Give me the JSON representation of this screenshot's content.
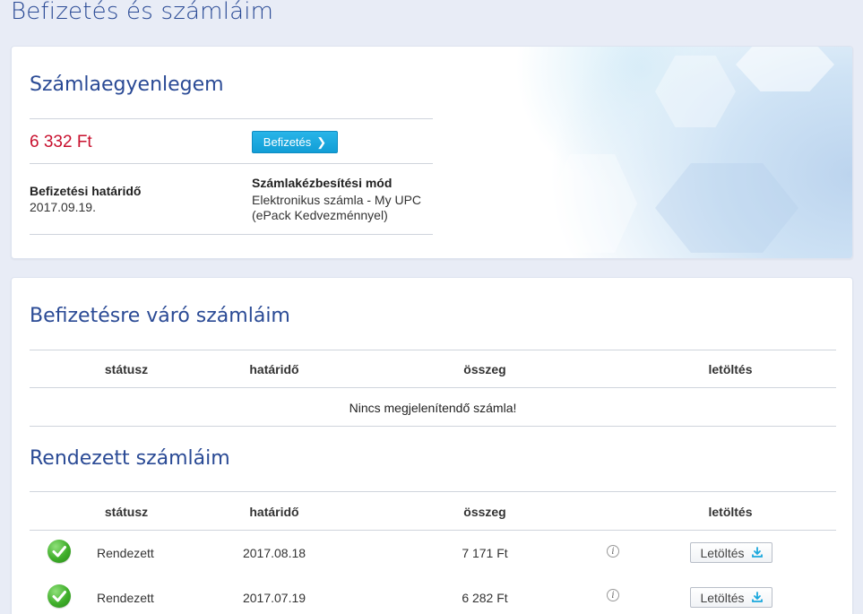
{
  "page": {
    "title": "Befizetés és számláim"
  },
  "balance": {
    "heading": "Számlaegyenlegem",
    "amount": "6 332 Ft",
    "pay_button": "Befizetés",
    "due_label": "Befizetési határidő",
    "due_value": "2017.09.19.",
    "delivery_label": "Számlakézbesítési mód",
    "delivery_value_line1": "Elektronikus számla - My UPC",
    "delivery_value_line2": "(ePack Kedvezménnyel)"
  },
  "pending": {
    "heading": "Befizetésre váró számláim",
    "columns": [
      "státusz",
      "határidő",
      "összeg",
      "letöltés"
    ],
    "empty_message": "Nincs megjelenítendő számla!"
  },
  "settled": {
    "heading": "Rendezett számláim",
    "columns": [
      "státusz",
      "határidő",
      "összeg",
      "letöltés"
    ],
    "rows": [
      {
        "status": "Rendezett",
        "due": "2017.08.18",
        "amount": "7 171 Ft",
        "download": "Letöltés"
      },
      {
        "status": "Rendezett",
        "due": "2017.07.19",
        "amount": "6 282 Ft",
        "download": "Letöltés"
      }
    ]
  },
  "icons": {
    "pay_chevron": "chevron-right-icon",
    "status": "checkmark-icon",
    "info": "info-icon",
    "download": "download-icon"
  },
  "colors": {
    "heading": "#2a4a95",
    "amount": "#c8102e",
    "pay_button": "#1ba8dd",
    "status_ok": "#3fae2a",
    "download_icon": "#1ba8dd"
  }
}
